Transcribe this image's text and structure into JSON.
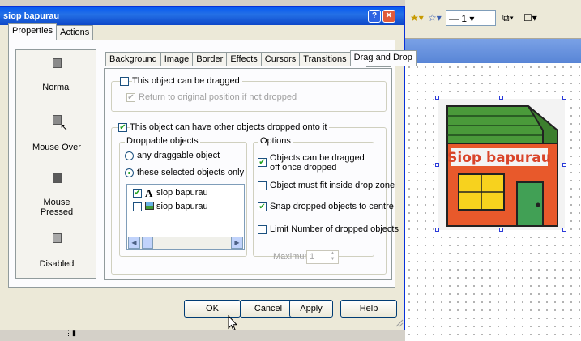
{
  "window": {
    "title": "siop bapurau"
  },
  "outer_tabs": [
    "Properties",
    "Actions"
  ],
  "states": [
    "Normal",
    "Mouse Over",
    "Mouse Pressed",
    "Disabled"
  ],
  "inner_tabs": [
    "Background",
    "Image",
    "Border",
    "Effects",
    "Cursors",
    "Transitions",
    "Drag and Drop"
  ],
  "drag": {
    "can_be_dragged_label": "This object can be dragged",
    "can_be_dragged": false,
    "return_label": "Return to original position if not dropped",
    "return_checked": true
  },
  "drop": {
    "can_have_dropped_label": "This object can have other objects dropped onto it",
    "can_have_dropped": true,
    "droppable_legend": "Droppable objects",
    "radio_any": "any draggable object",
    "radio_selected": "these selected objects only",
    "selected_choice": "these selected objects only",
    "list_items": [
      {
        "icon": "text-icon",
        "label": "siop bapurau",
        "checked": true
      },
      {
        "icon": "image-icon",
        "label": "siop bapurau",
        "checked": false
      }
    ],
    "options_legend": "Options",
    "options": [
      {
        "label": "Objects can be dragged off once dropped",
        "checked": true
      },
      {
        "label": "Object must fit inside drop zone",
        "checked": false
      },
      {
        "label": "Snap dropped objects to centre",
        "checked": true
      },
      {
        "label": "Limit Number of dropped objects",
        "checked": false
      }
    ],
    "maximum_label": "Maximum",
    "maximum_value": "1"
  },
  "buttons": {
    "ok": "OK",
    "cancel": "Cancel",
    "apply": "Apply",
    "help": "Help"
  },
  "toolbar": {
    "line_width": "1"
  },
  "shop_sign": "Siop bapurau",
  "colors": {
    "title_blue": "#0a5cf1",
    "shop_orange": "#e8592b",
    "roof_green": "#4a9a3a"
  }
}
